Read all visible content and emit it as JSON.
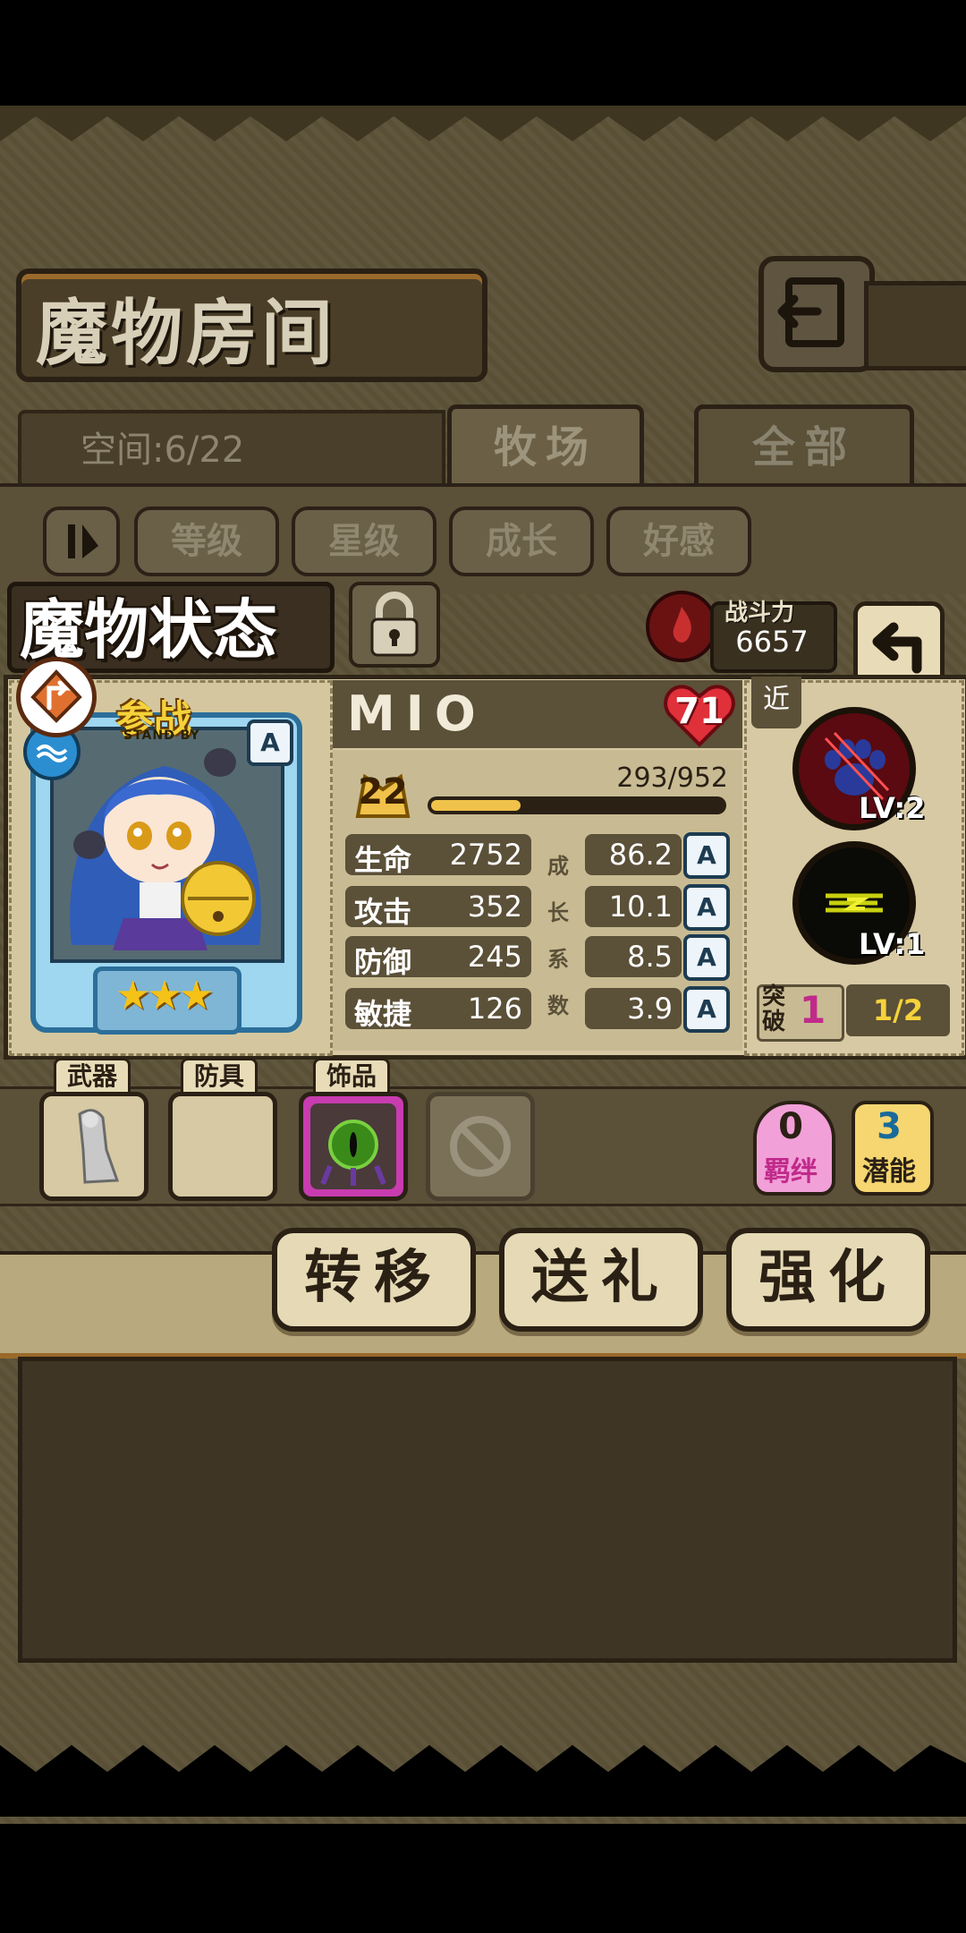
{
  "room": {
    "title": "魔物房间",
    "space_text": "空间:6/22",
    "tabs": [
      "牧场",
      "全部"
    ],
    "filters": [
      "等级",
      "星级",
      "成长",
      "好感"
    ]
  },
  "status": {
    "title": "魔物状态",
    "power_label": "战斗力",
    "power_value": "6657",
    "standby_label": "参战",
    "standby_sub": "STAND BY",
    "rank_badge": "A",
    "stars": 3
  },
  "monster": {
    "name": "MIO",
    "affection": "71",
    "level": "22",
    "xp_text": "293/952",
    "xp_progress": 0.308,
    "growth_label": [
      "成",
      "长",
      "系",
      "数"
    ],
    "stats": [
      {
        "label": "生命",
        "value": "2752",
        "growth": "86.2",
        "grade": "A"
      },
      {
        "label": "攻击",
        "value": "352",
        "growth": "10.1",
        "grade": "A"
      },
      {
        "label": "防御",
        "value": "245",
        "growth": "8.5",
        "grade": "A"
      },
      {
        "label": "敏捷",
        "value": "126",
        "growth": "3.9",
        "grade": "A"
      }
    ]
  },
  "skills": {
    "range_tag": "近",
    "items": [
      {
        "icon": "paw-slash-icon",
        "level": "LV:2"
      },
      {
        "icon": "lightning-icon",
        "level": "LV:1"
      }
    ],
    "break_label": "突破",
    "break_value": "1",
    "break_ratio": "1/2"
  },
  "equipment": {
    "slots": [
      {
        "label": "武器",
        "icon": "statue-weapon-icon"
      },
      {
        "label": "防具",
        "icon": ""
      },
      {
        "label": "饰品",
        "icon": "eye-charm-icon"
      }
    ],
    "bond_value": "0",
    "bond_label": "羁绊",
    "potential_value": "3",
    "potential_label": "潜能"
  },
  "actions": [
    "转移",
    "送礼",
    "强化"
  ],
  "colors": {
    "board": "#5c5238",
    "panel": "#d6c9a3",
    "dark_bar": "#5b5038",
    "gold": "#f5d23a",
    "heart": "#e0303a",
    "frame_blue": "#2b6f9a"
  }
}
